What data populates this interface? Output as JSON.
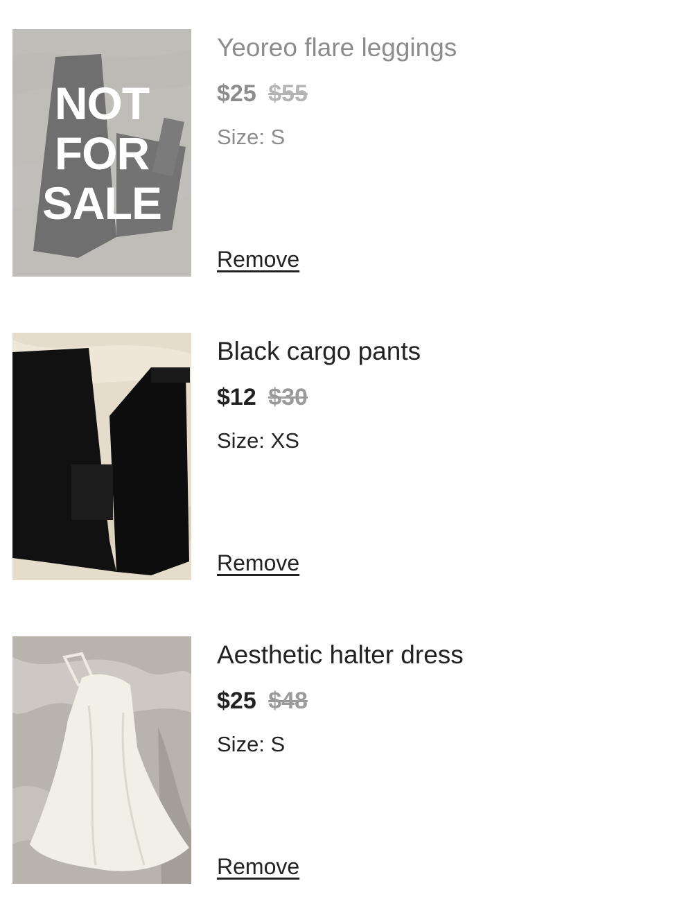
{
  "items": [
    {
      "title": "Yeoreo flare leggings",
      "price": "$25",
      "original_price": "$55",
      "size": "Size: S",
      "remove_label": "Remove",
      "status": "unavailable",
      "overlay_text": [
        "NOT",
        "FOR",
        "SALE"
      ]
    },
    {
      "title": "Black cargo pants",
      "price": "$12",
      "original_price": "$30",
      "size": "Size: XS",
      "remove_label": "Remove"
    },
    {
      "title": "Aesthetic halter dress",
      "price": "$25",
      "original_price": "$48",
      "size": "Size: S",
      "remove_label": "Remove"
    }
  ],
  "colors": {
    "text": "#222222",
    "muted_text": "#8c8c8c",
    "strike_price": "#9a9a9a",
    "background": "#ffffff"
  }
}
